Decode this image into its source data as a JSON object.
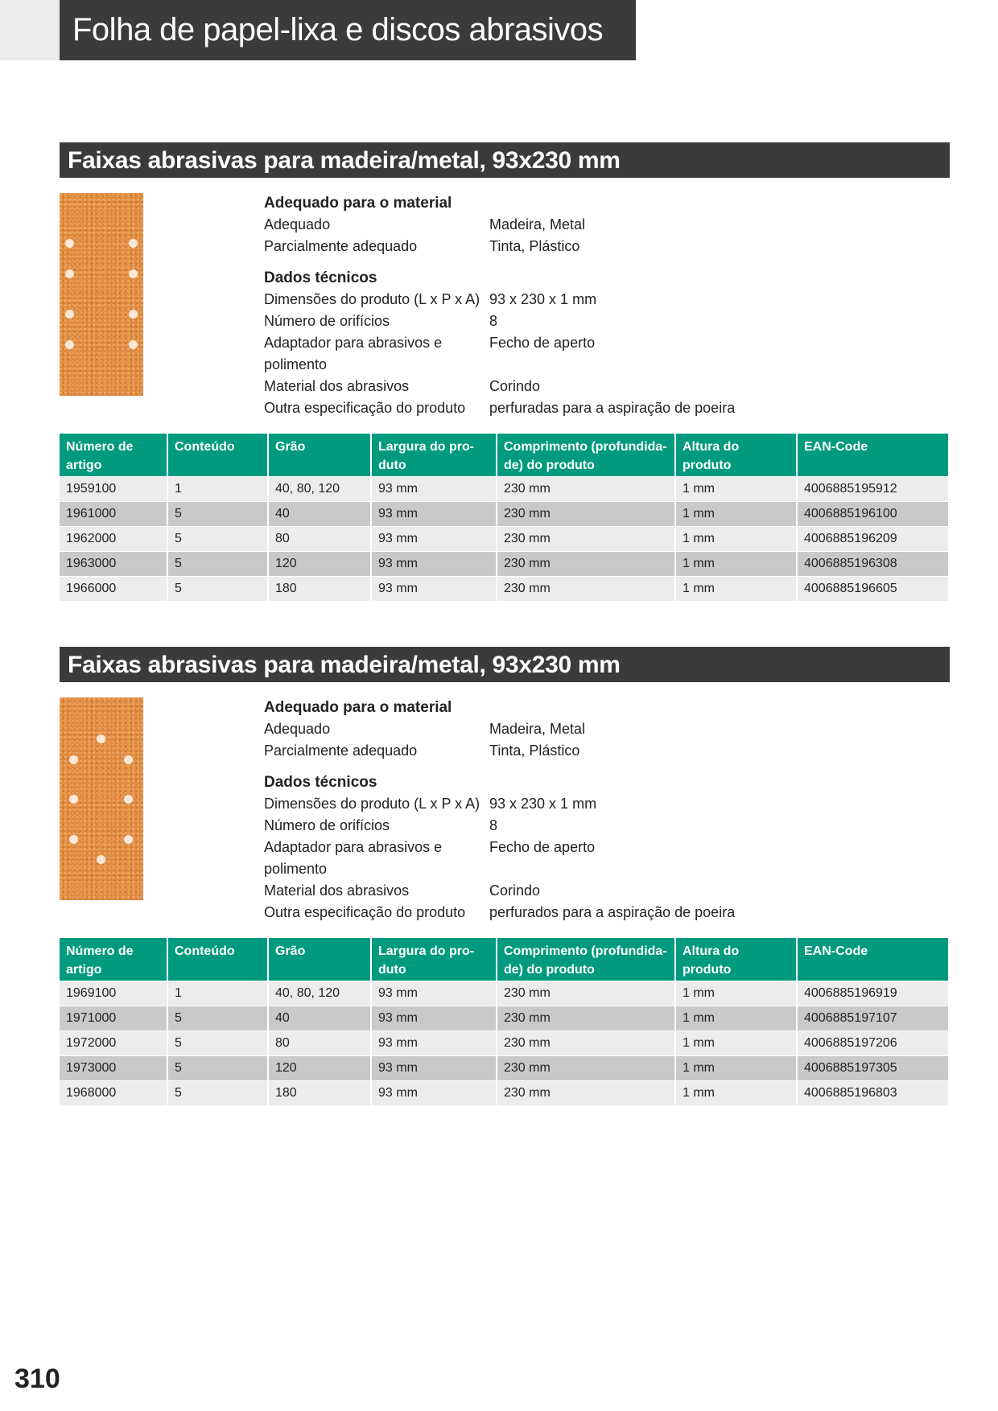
{
  "page": {
    "title": "Folha de papel-lixa e discos abrasivos",
    "number": "310"
  },
  "sections": [
    {
      "title": "Faixas abrasivas para madeira/metal, 93x230 mm",
      "image_icon": "sanding-strip-8-holes",
      "specs": {
        "material_title": "Adequado para o material",
        "suitable_label": "Adequado",
        "suitable_value": "Madeira, Metal",
        "partial_label": "Parcialmente adequado",
        "partial_value": "Tinta, Plástico",
        "tech_title": "Dados técnicos",
        "dimensions_label": "Dimensões do produto (L x P x A)",
        "dimensions_value": "93 x 230 x 1 mm",
        "holes_label": "Número de orifícios",
        "holes_value": "8",
        "adapter_label": "Adaptador para abrasivos e polimento",
        "adapter_value": "Fecho de aperto",
        "material_label": "Material dos abrasivos",
        "material_value": "Corindo",
        "other_label": "Outra especificação do produto",
        "other_value": "perfuradas para a aspiração de poeira"
      },
      "columns": [
        "Número de artigo",
        "Conteúdo",
        "Grão",
        "Largura do pro-duto",
        "Comprimento (profundida-de) do produto",
        "Altura do produto",
        "EAN-Code"
      ],
      "rows": [
        [
          "1959100",
          "1",
          "40, 80, 120",
          "93 mm",
          "230 mm",
          "1 mm",
          "4006885195912"
        ],
        [
          "1961000",
          "5",
          "40",
          "93 mm",
          "230 mm",
          "1 mm",
          "4006885196100"
        ],
        [
          "1962000",
          "5",
          "80",
          "93 mm",
          "230 mm",
          "1 mm",
          "4006885196209"
        ],
        [
          "1963000",
          "5",
          "120",
          "93 mm",
          "230 mm",
          "1 mm",
          "4006885196308"
        ],
        [
          "1966000",
          "5",
          "180",
          "93 mm",
          "230 mm",
          "1 mm",
          "4006885196605"
        ]
      ]
    },
    {
      "title": "Faixas abrasivas para madeira/metal, 93x230 mm",
      "image_icon": "sanding-strip-8-holes-offset",
      "specs": {
        "material_title": "Adequado para o material",
        "suitable_label": "Adequado",
        "suitable_value": "Madeira, Metal",
        "partial_label": "Parcialmente adequado",
        "partial_value": "Tinta, Plástico",
        "tech_title": "Dados técnicos",
        "dimensions_label": "Dimensões do produto (L x P x A)",
        "dimensions_value": "93 x 230 x 1 mm",
        "holes_label": "Número de orifícios",
        "holes_value": "8",
        "adapter_label": "Adaptador para abrasivos e polimento",
        "adapter_value": "Fecho de aperto",
        "material_label": "Material dos abrasivos",
        "material_value": "Corindo",
        "other_label": "Outra especificação do produto",
        "other_value": "perfurados para a aspiração de poeira"
      },
      "columns": [
        "Número de artigo",
        "Conteúdo",
        "Grão",
        "Largura do pro-duto",
        "Comprimento (profundida-de) do produto",
        "Altura do produto",
        "EAN-Code"
      ],
      "rows": [
        [
          "1969100",
          "1",
          "40, 80, 120",
          "93 mm",
          "230 mm",
          "1 mm",
          "4006885196919"
        ],
        [
          "1971000",
          "5",
          "40",
          "93 mm",
          "230 mm",
          "1 mm",
          "4006885197107"
        ],
        [
          "1972000",
          "5",
          "80",
          "93 mm",
          "230 mm",
          "1 mm",
          "4006885197206"
        ],
        [
          "1973000",
          "5",
          "120",
          "93 mm",
          "230 mm",
          "1 mm",
          "4006885197305"
        ],
        [
          "1968000",
          "5",
          "180",
          "93 mm",
          "230 mm",
          "1 mm",
          "4006885196803"
        ]
      ]
    }
  ],
  "colors": {
    "header_bg": "#3b3b3b",
    "table_header_bg": "#009a7f",
    "row_light": "#ececec",
    "row_dark": "#c9c9c9",
    "abrasive": "#e08a3e"
  }
}
